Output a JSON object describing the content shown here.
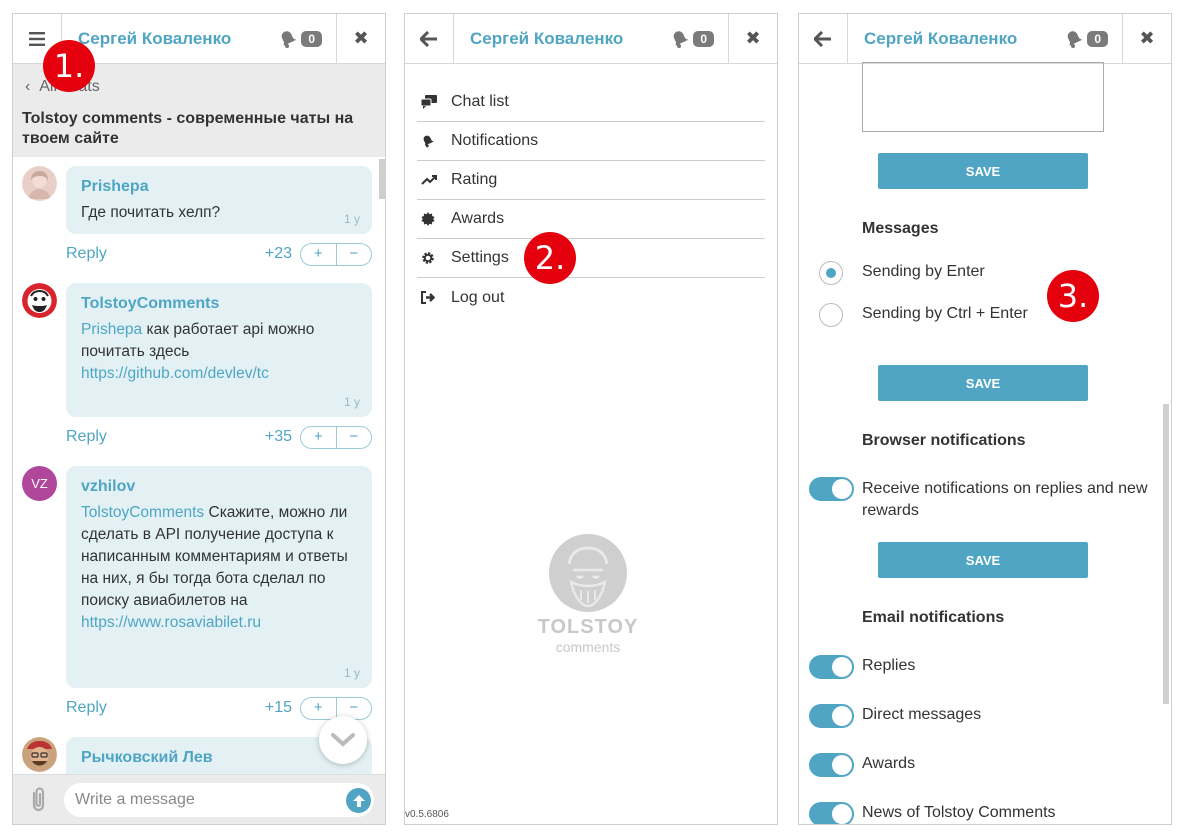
{
  "header": {
    "user_name": "Сергей Коваленко",
    "notif_count": "0"
  },
  "steps": [
    "1.",
    "2.",
    "3."
  ],
  "chat": {
    "back_label": "All chats",
    "title": "Tolstoy comments - современные чаты на твоем сайте",
    "reply_label": "Reply",
    "vote_up": "+",
    "vote_down": "−",
    "messages": [
      {
        "author": "Prishepa",
        "text": "Где почитать хелп?",
        "time": "1 y",
        "score": "+23"
      },
      {
        "author": "TolstoyComments",
        "mention": "Prishepa",
        "text": " как работает api можно почитать здесь",
        "link": "https://github.com/devlev/tc",
        "time": "1 y",
        "score": "+35"
      },
      {
        "author": "vzhilov",
        "initials": "VZ",
        "mention": "TolstoyComments",
        "text": " Скажите, можно ли сделать в API получение доступа к написанным комментариям и ответы на них, я бы тогда бота сделал по поиску авиабилетов на",
        "link": "https://www.rosaviabilet.ru",
        "time": "1 y",
        "score": "+15"
      },
      {
        "author": "Рычковский Лев"
      }
    ],
    "placeholder": "Write a message",
    "colors": {
      "accent": "#4fa5c3",
      "avatar_vz": "#b0479a"
    }
  },
  "menu": {
    "items": [
      {
        "label": "Chat list",
        "icon": "chat-list-icon"
      },
      {
        "label": "Notifications",
        "icon": "bell-icon"
      },
      {
        "label": "Rating",
        "icon": "trending-icon"
      },
      {
        "label": "Awards",
        "icon": "award-icon"
      },
      {
        "label": "Settings",
        "icon": "gear-icon"
      },
      {
        "label": "Log out",
        "icon": "logout-icon"
      }
    ],
    "logo_word": "TOLSTOY",
    "logo_sub": "comments",
    "version": "v0.5.6806"
  },
  "settings": {
    "save_label": "SAVE",
    "messages_title": "Messages",
    "send_enter": "Sending by Enter",
    "send_ctrl_enter": "Sending by Ctrl + Enter",
    "send_mode_selected": "Sending by Enter",
    "browser_title": "Browser notifications",
    "browser_option": "Receive notifications on replies and new rewards",
    "email_title": "Email notifications",
    "email_options": [
      "Replies",
      "Direct messages",
      "Awards",
      "News of Tolstoy Comments"
    ]
  }
}
